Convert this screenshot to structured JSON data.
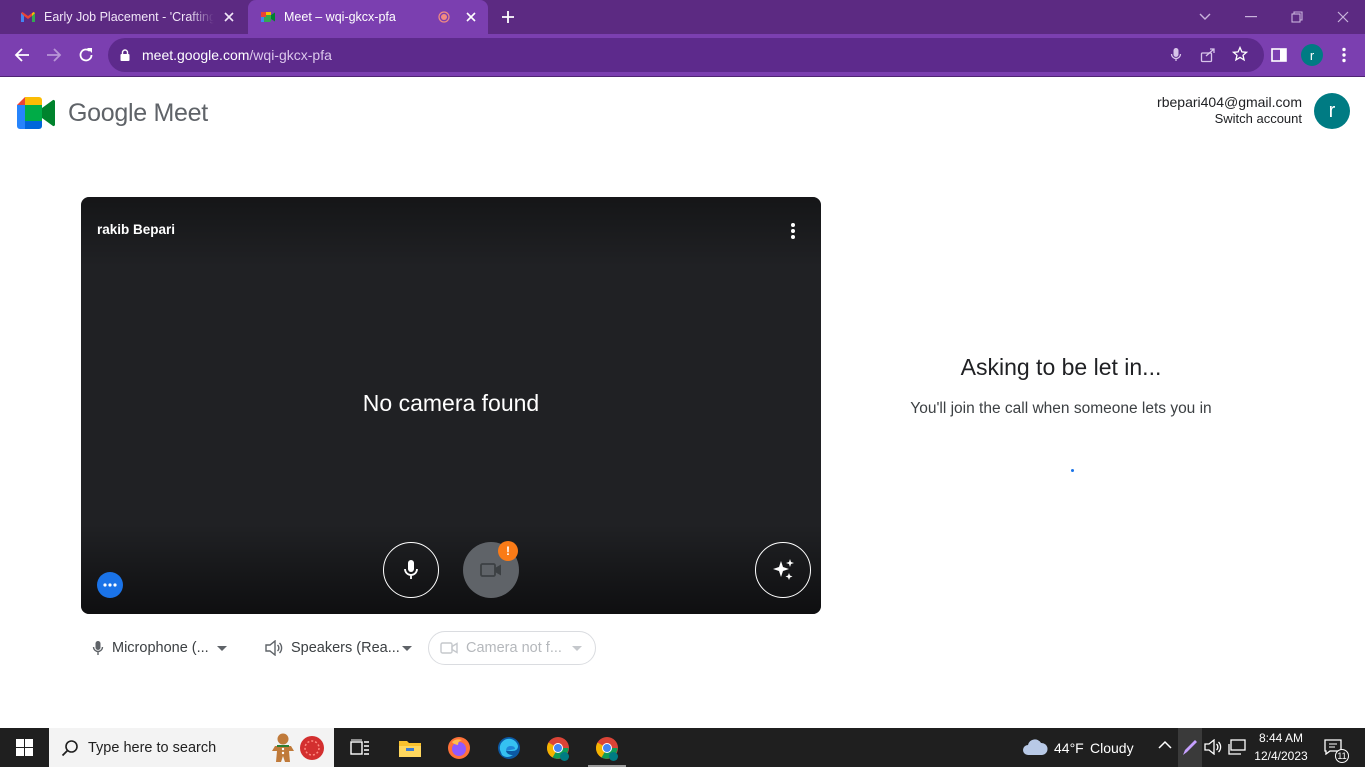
{
  "browser": {
    "tabs": [
      {
        "label": "Early Job Placement - 'Crafting your",
        "favicon": "gmail-icon",
        "active": false
      },
      {
        "label": "Meet – wqi-gkcx-pfa",
        "favicon": "meet-icon",
        "active": true
      }
    ],
    "url_host": "meet.google.com",
    "url_path": "/wqi-gkcx-pfa",
    "profile_initial": "r",
    "colors": {
      "frame": "#5c2a82",
      "toolbar": "#7b3fb0",
      "omnibox": "#5d2a8c"
    }
  },
  "meet": {
    "product_name": "Google Meet",
    "account_email": "rbepari404@gmail.com",
    "switch_account_label": "Switch account",
    "avatar_initial": "r",
    "avatar_color": "#007b83",
    "preview": {
      "participant_name": "rakib Bepari",
      "status_text": "No camera found",
      "camera_badge": "!"
    },
    "devices": {
      "microphone": "Microphone (...",
      "speakers": "Speakers (Rea...",
      "camera": "Camera not f..."
    },
    "lobby": {
      "title": "Asking to be let in...",
      "subtitle": "You'll join the call when someone lets you in"
    },
    "accent": "#1a73e8"
  },
  "taskbar": {
    "search_placeholder": "Type here to search",
    "weather_temp": "44°F",
    "weather_condition": "Cloudy",
    "time": "8:44 AM",
    "date": "12/4/2023",
    "notification_count": "11",
    "pinned_apps": [
      "task-view-icon",
      "file-explorer-icon",
      "firefox-icon",
      "edge-icon",
      "chrome-icon",
      "chrome-profile-icon"
    ]
  }
}
